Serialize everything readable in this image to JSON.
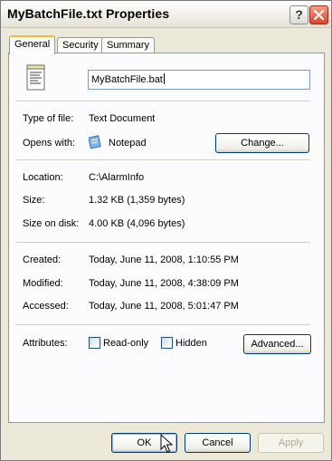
{
  "window": {
    "title": "MyBatchFile.txt Properties"
  },
  "titlebar": {
    "help_label": "?"
  },
  "tabs": [
    {
      "label": "General"
    },
    {
      "label": "Security"
    },
    {
      "label": "Summary"
    }
  ],
  "general": {
    "file_name": "MyBatchFile.bat",
    "type_label": "Type of file:",
    "type_value": "Text Document",
    "opens_label": "Opens with:",
    "opens_value": "Notepad",
    "change_button": "Change...",
    "location_label": "Location:",
    "location_value": "C:\\AlarmInfo",
    "size_label": "Size:",
    "size_value": "1.32 KB (1,359 bytes)",
    "size_disk_label": "Size on disk:",
    "size_disk_value": "4.00 KB (4,096 bytes)",
    "created_label": "Created:",
    "created_value": "Today, June 11, 2008, 1:10:55 PM",
    "modified_label": "Modified:",
    "modified_value": "Today, June 11, 2008, 4:38:09 PM",
    "accessed_label": "Accessed:",
    "accessed_value": "Today, June 11, 2008, 5:01:47 PM",
    "attributes_label": "Attributes:",
    "readonly_label": "Read-only",
    "hidden_label": "Hidden",
    "advanced_button": "Advanced..."
  },
  "footer": {
    "ok_label": "OK",
    "cancel_label": "Cancel",
    "apply_label": "Apply"
  },
  "icons": {
    "file": "text-file-icon",
    "notepad": "notepad-icon",
    "close": "close-icon",
    "pointer": "mouse-pointer-icon"
  }
}
